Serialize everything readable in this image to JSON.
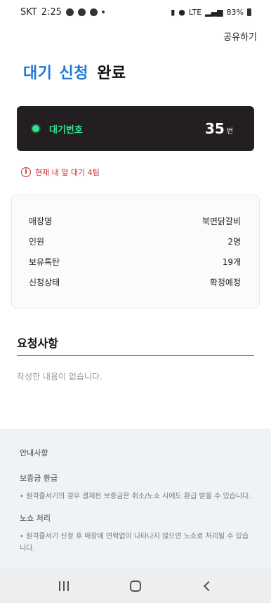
{
  "status_bar": {
    "carrier": "SKT",
    "time": "2:25",
    "network": "LTE",
    "battery": "83%"
  },
  "header": {
    "share_label": "공유하기"
  },
  "title": {
    "part1": "대기",
    "part2": "신청",
    "part3": "완료"
  },
  "wait_card": {
    "label": "대기번호",
    "number": "35",
    "unit": "번"
  },
  "notice": {
    "text": "현재 내 앞 대기 4팀"
  },
  "info": {
    "rows": [
      {
        "label": "매장명",
        "value": "북면닭갈비"
      },
      {
        "label": "인원",
        "value": "2명"
      },
      {
        "label": "보유톡탄",
        "value": "19개"
      },
      {
        "label": "신청상태",
        "value": "확정예정"
      }
    ]
  },
  "request": {
    "title": "요청사항",
    "empty_text": "작성한 내용이 없습니다."
  },
  "guide": {
    "title": "안내사항",
    "sections": [
      {
        "heading": "보증금 환급",
        "text": "• 원격줄서기의 경우 결제된 보증금은 취소/노쇼 시에도 환급 받을 수 있습니다."
      },
      {
        "heading": "노쇼 처리",
        "text": "• 원격줄서기 신청 후 매장에 연락없이 나타나지 않으면 노쇼로 처리될 수 있습니다."
      }
    ]
  }
}
